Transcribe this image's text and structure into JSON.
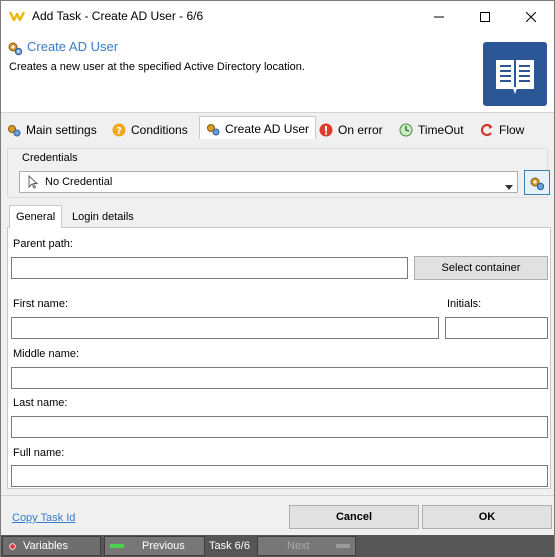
{
  "window": {
    "title": "Add Task - Create AD User - 6/6"
  },
  "header": {
    "title": "Create AD User",
    "description": "Creates a new user at the specified Active Directory location."
  },
  "tabs": [
    {
      "label": "Main settings",
      "icon": "gears-icon"
    },
    {
      "label": "Conditions",
      "icon": "question-icon"
    },
    {
      "label": "Create AD User",
      "icon": "gears-icon",
      "active": true
    },
    {
      "label": "On error",
      "icon": "error-icon"
    },
    {
      "label": "TimeOut",
      "icon": "clock-icon"
    },
    {
      "label": "Flow",
      "icon": "flow-icon"
    }
  ],
  "credentials": {
    "group_label": "Credentials",
    "selected": "No Credential"
  },
  "inner_tabs": [
    {
      "label": "General",
      "active": true
    },
    {
      "label": "Login details"
    }
  ],
  "form": {
    "parent_path_label": "Parent path:",
    "parent_path_value": "",
    "select_container_label": "Select container",
    "first_name_label": "First name:",
    "initials_label": "Initials:",
    "middle_name_label": "Middle name:",
    "last_name_label": "Last name:",
    "full_name_label": "Full name:"
  },
  "footer": {
    "copy_task_id": "Copy Task Id",
    "cancel": "Cancel",
    "ok": "OK"
  },
  "statusbar": {
    "variables": "Variables",
    "previous": "Previous",
    "task": "Task 6/6",
    "next": "Next"
  },
  "colors": {
    "accent": "#3a7cc7",
    "book_tile": "#2b5797",
    "statusbar": "#565656"
  }
}
